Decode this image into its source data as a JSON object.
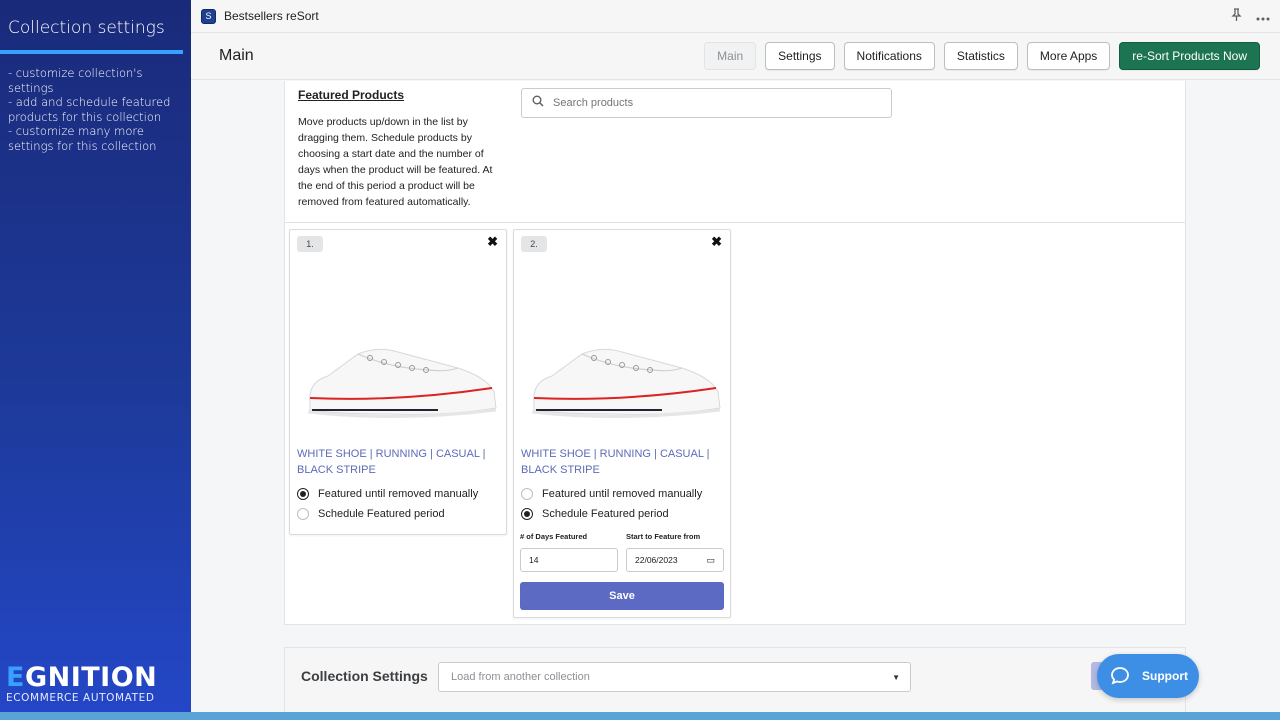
{
  "promo": {
    "title": "Collection settings",
    "lines": [
      "- customize collection's settings",
      "- add and schedule featured products for this collection",
      "- customize many more settings for this collection"
    ],
    "logo_first": "E",
    "logo_rest": "GNITION",
    "tagline": "ECOMMERCE AUTOMATED"
  },
  "app": {
    "name": "Bestsellers reSort",
    "icon_letter": "S"
  },
  "header": {
    "title": "Main",
    "nav": {
      "main": "Main",
      "settings": "Settings",
      "notifications": "Notifications",
      "statistics": "Statistics",
      "more_apps": "More Apps",
      "resort": "re-Sort Products Now"
    }
  },
  "featured": {
    "title": "Featured Products",
    "description": "Move products up/down in the list by dragging them. Schedule products by choosing a start date and the number of days when the product will be featured. At the end of this period a product will be removed from featured automatically.",
    "search_placeholder": "Search products",
    "products": [
      {
        "number": "1.",
        "name": "WHITE SHOE | RUNNING | CASUAL | BLACK STRIPE",
        "option_manual": "Featured until removed manually",
        "option_schedule": "Schedule Featured period",
        "selected": "manual"
      },
      {
        "number": "2.",
        "name": "WHITE SHOE | RUNNING | CASUAL | BLACK STRIPE",
        "option_manual": "Featured until removed manually",
        "option_schedule": "Schedule Featured period",
        "selected": "schedule",
        "days_label": "# of Days Featured",
        "days_value": "14",
        "start_label": "Start to Feature from",
        "start_value": "22/06/2023",
        "save_label": "Save"
      }
    ]
  },
  "collection_settings": {
    "title": "Collection Settings",
    "select_placeholder": "Load from another collection"
  },
  "support": {
    "label": "Support"
  },
  "colors": {
    "accent_primary": "#1d7453",
    "save_button": "#5c6ac4",
    "product_link": "#5b6bb8",
    "support": "#3d8fe6",
    "promo_accent": "#3aa0ff"
  }
}
